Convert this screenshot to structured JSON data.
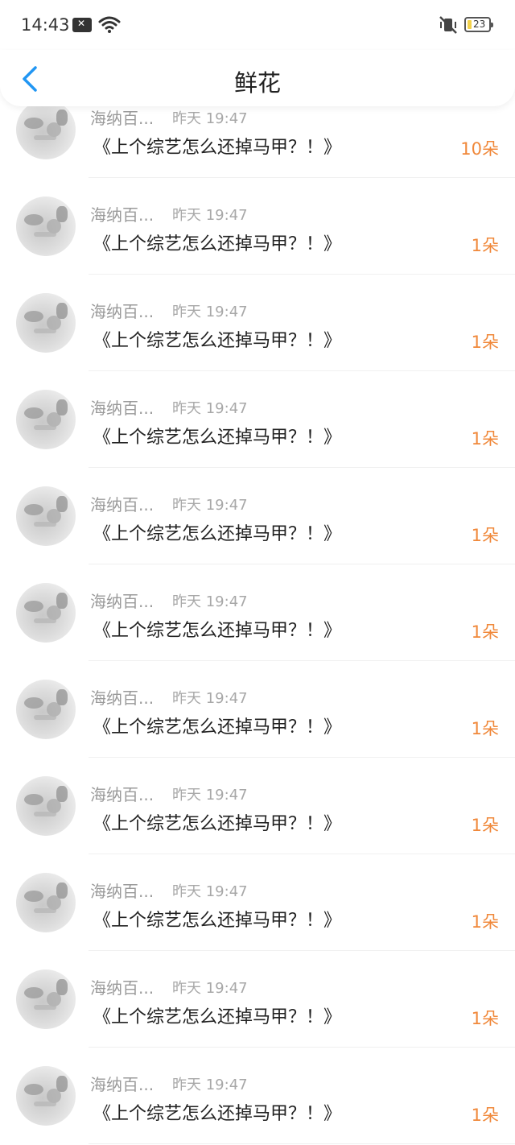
{
  "status_bar": {
    "time": "14:43",
    "battery": "23",
    "icons": [
      "notification-x-icon",
      "wifi-icon",
      "silent-mode-icon",
      "battery-icon"
    ]
  },
  "header": {
    "title": "鲜花",
    "back_icon": "chevron-left-icon"
  },
  "colors": {
    "back_accent": "#2196f3",
    "count_orange": "#f0883a",
    "meta_gray": "#9a9a9a"
  },
  "rows": [
    {
      "name": "海纳百...",
      "time": "昨天 19:47",
      "message": "《上个综艺怎么还掉马甲？！》",
      "count": "10朵"
    },
    {
      "name": "海纳百...",
      "time": "昨天 19:47",
      "message": "《上个综艺怎么还掉马甲？！》",
      "count": "1朵"
    },
    {
      "name": "海纳百...",
      "time": "昨天 19:47",
      "message": "《上个综艺怎么还掉马甲？！》",
      "count": "1朵"
    },
    {
      "name": "海纳百...",
      "time": "昨天 19:47",
      "message": "《上个综艺怎么还掉马甲？！》",
      "count": "1朵"
    },
    {
      "name": "海纳百...",
      "time": "昨天 19:47",
      "message": "《上个综艺怎么还掉马甲？！》",
      "count": "1朵"
    },
    {
      "name": "海纳百...",
      "time": "昨天 19:47",
      "message": "《上个综艺怎么还掉马甲？！》",
      "count": "1朵"
    },
    {
      "name": "海纳百...",
      "time": "昨天 19:47",
      "message": "《上个综艺怎么还掉马甲？！》",
      "count": "1朵"
    },
    {
      "name": "海纳百...",
      "time": "昨天 19:47",
      "message": "《上个综艺怎么还掉马甲？！》",
      "count": "1朵"
    },
    {
      "name": "海纳百...",
      "time": "昨天 19:47",
      "message": "《上个综艺怎么还掉马甲？！》",
      "count": "1朵"
    },
    {
      "name": "海纳百...",
      "time": "昨天 19:47",
      "message": "《上个综艺怎么还掉马甲？！》",
      "count": "1朵"
    },
    {
      "name": "海纳百...",
      "time": "昨天 19:47",
      "message": "《上个综艺怎么还掉马甲？！》",
      "count": "1朵"
    }
  ]
}
